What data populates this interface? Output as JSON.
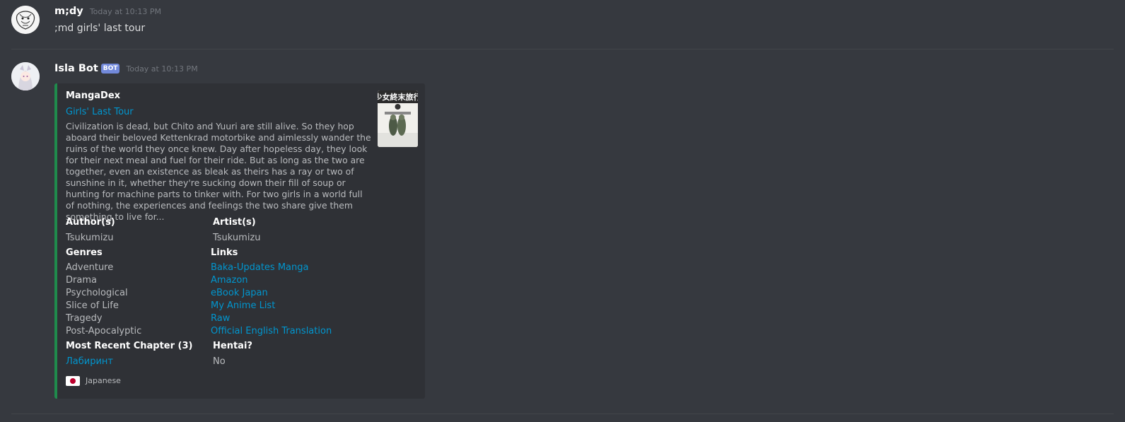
{
  "message1": {
    "username": "m;dy",
    "timestamp": "Today at 10:13 PM",
    "content": ";md girls' last tour"
  },
  "message2": {
    "username": "Isla Bot",
    "bot_tag": "BOT",
    "timestamp": "Today at 10:13 PM",
    "embed": {
      "provider": "MangaDex",
      "title": "Girls' Last Tour",
      "description": "Civilization is dead, but Chito and Yuuri are still alive. So they hop aboard their beloved Kettenkrad motorbike and aimlessly wander the ruins of the world they once knew. Day after hopeless day, they look for their next meal and fuel for their ride. But as long as the two are together, even an existence as bleak as theirs has a ray or two of sunshine in it, whether they're sucking down their fill of soup or hunting for machine parts to tinker with. For two girls in a world full of nothing, the experiences and feelings the two share give them something to live for...",
      "accent_color": "#1f8b4c",
      "thumbnail_icon": "manga-cover-thumbnail",
      "fields": {
        "authors_name": "Author(s)",
        "authors_value": "Tsukumizu",
        "artists_name": "Artist(s)",
        "artists_value": "Tsukumizu",
        "genres_name": "Genres",
        "genres": [
          "Adventure",
          "Drama",
          "Psychological",
          "Slice of Life",
          "Tragedy",
          "Post-Apocalyptic"
        ],
        "links_name": "Links",
        "links": [
          "Baka-Updates Manga",
          "Amazon",
          "eBook Japan",
          "My Anime List",
          "Raw",
          "Official English Translation"
        ],
        "chapter_name": "Most Recent Chapter (3)",
        "chapter_value": "Лабиринт",
        "hentai_name": "Hentai?",
        "hentai_value": "No"
      },
      "footer": {
        "flag_icon": "japan-flag-icon",
        "text": "Japanese"
      }
    }
  },
  "colors": {
    "background": "#36393f",
    "embed_background": "#2f3136",
    "link": "#0096cf",
    "bot_tag": "#7289da"
  }
}
